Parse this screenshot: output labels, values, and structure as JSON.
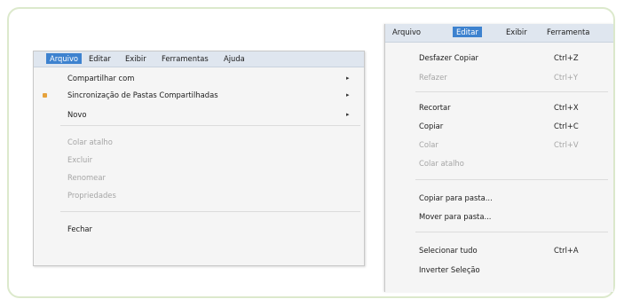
{
  "left_menu": {
    "menubar": [
      "Arquivo",
      "Editar",
      "Exibir",
      "Ferramentas",
      "Ajuda"
    ],
    "items": [
      {
        "label": "Compartilhar com",
        "disabled": false,
        "submenu": true
      },
      {
        "label": "Sincronização de Pastas Compartilhadas",
        "disabled": false,
        "submenu": true,
        "icon": "sync-folder-icon"
      },
      {
        "label": "Novo",
        "disabled": false,
        "submenu": true
      },
      {
        "label": "Colar atalho",
        "disabled": true
      },
      {
        "label": "Excluir",
        "disabled": true
      },
      {
        "label": "Renomear",
        "disabled": true
      },
      {
        "label": "Propriedades",
        "disabled": true
      },
      {
        "label": "Fechar",
        "disabled": false
      }
    ],
    "submenu_arrow": "▸"
  },
  "right_menu": {
    "menubar": [
      "Arquivo",
      "Editar",
      "Exibir",
      "Ferramenta"
    ],
    "items": [
      {
        "label": "Desfazer Copiar",
        "shortcut": "Ctrl+Z",
        "disabled": false
      },
      {
        "label": "Refazer",
        "shortcut": "Ctrl+Y",
        "disabled": true
      },
      {
        "label": "Recortar",
        "shortcut": "Ctrl+X",
        "disabled": false
      },
      {
        "label": "Copiar",
        "shortcut": "Ctrl+C",
        "disabled": false
      },
      {
        "label": "Colar",
        "shortcut": "Ctrl+V",
        "disabled": true
      },
      {
        "label": "Colar atalho",
        "shortcut": "",
        "disabled": true
      },
      {
        "label": "Copiar para pasta...",
        "shortcut": "",
        "disabled": false
      },
      {
        "label": "Mover para pasta...",
        "shortcut": "",
        "disabled": false
      },
      {
        "label": "Selecionar tudo",
        "shortcut": "Ctrl+A",
        "disabled": false
      },
      {
        "label": "Inverter Seleção",
        "shortcut": "",
        "disabled": false
      }
    ]
  },
  "colors": {
    "highlight": "#3d82cf",
    "disabled_text": "#a5a5a5",
    "frame_border": "#dce9cc"
  }
}
